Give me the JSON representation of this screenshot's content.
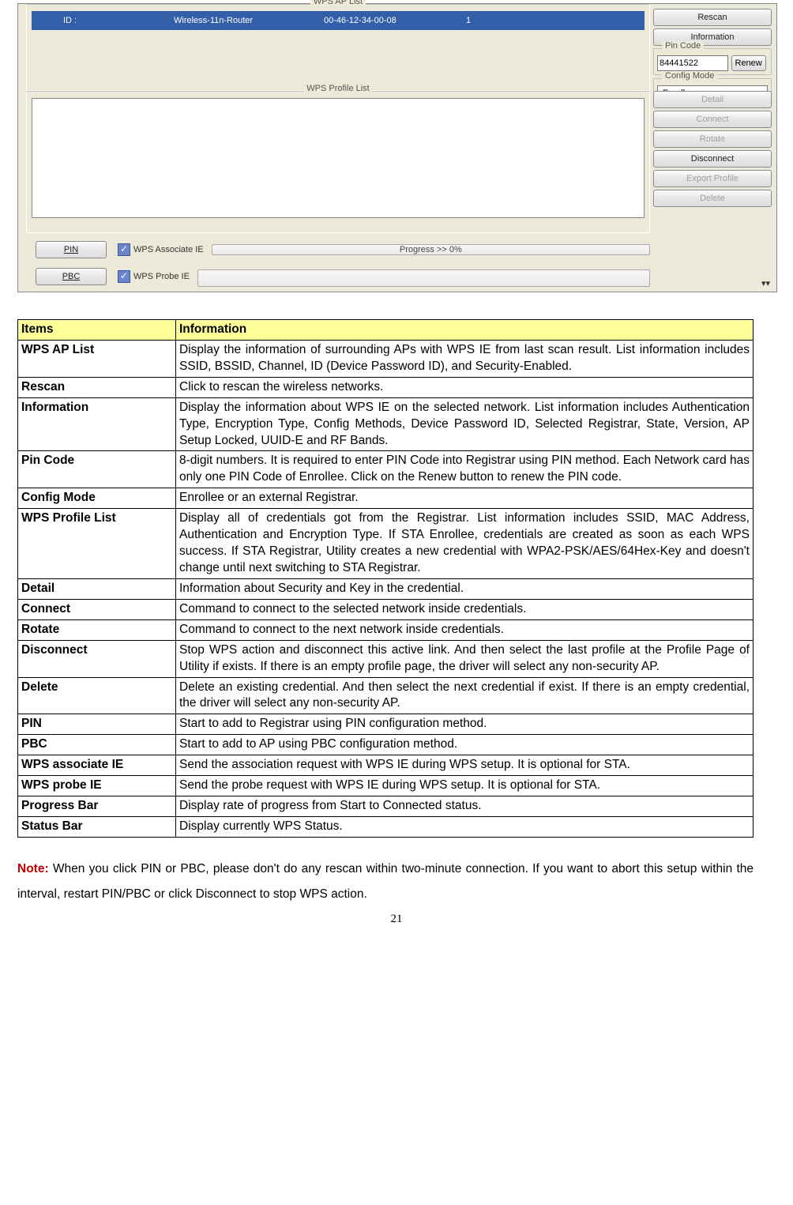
{
  "panel": {
    "apList": {
      "legend": "WPS AP List",
      "row": {
        "col1": "",
        "id_label": "ID :",
        "ssid": "Wireless-11n-Router",
        "bssid": "00-46-12-34-00-08",
        "ch": "1"
      }
    },
    "profileList": {
      "legend": "WPS Profile List"
    },
    "sideTop": {
      "rescan": "Rescan",
      "information": "Information",
      "pinCodeLegend": "Pin Code",
      "pinValue": "84441522",
      "renew": "Renew",
      "configLegend": "Config Mode",
      "configValue": "Enrollee"
    },
    "sideMid": {
      "detail": "Detail",
      "connect": "Connect",
      "rotate": "Rotate",
      "disconnect": "Disconnect",
      "export": "Export Profile",
      "delete": "Delete"
    },
    "bottom": {
      "pin": "PIN",
      "pbc": "PBC",
      "assoc": "WPS Associate IE",
      "probe": "WPS Probe IE",
      "progress": "Progress >> 0%"
    }
  },
  "table": {
    "head_items": "Items",
    "head_info": "Information",
    "rows": [
      {
        "item": "WPS AP List",
        "desc": "Display the information of surrounding APs with WPS IE from last scan result. List information includes SSID, BSSID, Channel, ID (Device Password ID), and Security-Enabled."
      },
      {
        "item": "Rescan",
        "desc": "Click to rescan the wireless networks."
      },
      {
        "item": "Information",
        "desc": "Display the information about WPS IE on the selected network. List information includes Authentication Type, Encryption Type, Config Methods, Device Password ID, Selected Registrar, State, Version, AP Setup Locked, UUID-E and RF Bands."
      },
      {
        "item": "Pin Code",
        "desc": "8-digit numbers. It is required to enter PIN Code into Registrar using PIN method. Each Network card has only one PIN Code of Enrollee. Click on the Renew button to renew the PIN code."
      },
      {
        "item": "Config Mode",
        "desc": "Enrollee or an external Registrar."
      },
      {
        "item": "WPS Profile List",
        "desc": "Display all of credentials got from the Registrar. List information includes SSID, MAC Address, Authentication and Encryption Type. If STA Enrollee, credentials are created as soon as each WPS success. If STA Registrar, Utility creates a new credential with WPA2-PSK/AES/64Hex-Key and doesn't change until next switching to STA Registrar."
      },
      {
        "item": "Detail",
        "desc": "Information about Security and Key in the credential."
      },
      {
        "item": "Connect",
        "desc": "Command to connect to the selected network inside credentials."
      },
      {
        "item": "Rotate",
        "desc": "Command to connect to the next network inside credentials."
      },
      {
        "item": "Disconnect",
        "desc": "Stop WPS action and disconnect this active link. And then select the last profile at the Profile Page of Utility if exists. If there is an empty profile page, the driver will select any non-security AP."
      },
      {
        "item": "Delete",
        "desc": "Delete an existing credential. And then select the next credential if exist. If there is an empty credential, the driver will select any non-security AP."
      },
      {
        "item": "PIN",
        "desc": "Start to add to Registrar using PIN configuration method."
      },
      {
        "item": "PBC",
        "desc": "Start to add to AP using PBC configuration method."
      },
      {
        "item": "WPS associate IE",
        "desc": "Send the association request with WPS IE during WPS setup. It is optional for STA."
      },
      {
        "item": "WPS probe IE",
        "desc": "Send the probe request with WPS IE during WPS setup. It is optional for STA."
      },
      {
        "item": "Progress Bar",
        "desc": "Display rate of progress from Start to Connected status."
      },
      {
        "item": "Status Bar",
        "desc": "Display currently WPS Status."
      }
    ]
  },
  "note": {
    "label": "Note:",
    "text": " When you click PIN or PBC, please don't do any rescan within two-minute connection. If you want to abort this setup within the interval, restart PIN/PBC or click Disconnect to stop WPS action."
  },
  "pageNumber": "21"
}
